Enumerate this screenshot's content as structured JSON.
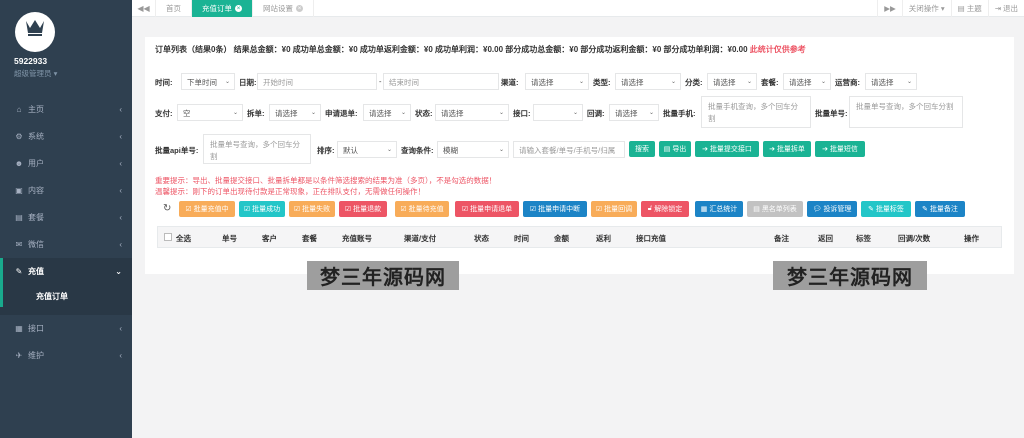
{
  "sidebar": {
    "username": "5922933",
    "role": "超级管理员 ▾",
    "items": [
      {
        "label": "主页",
        "icon": "home-icon",
        "glyph": "⌂"
      },
      {
        "label": "系统",
        "icon": "gears-icon",
        "glyph": "⚙"
      },
      {
        "label": "用户",
        "icon": "users-icon",
        "glyph": "☻"
      },
      {
        "label": "内容",
        "icon": "folder-icon",
        "glyph": "▣"
      },
      {
        "label": "套餐",
        "icon": "file-icon",
        "glyph": "▤"
      },
      {
        "label": "微信",
        "icon": "wechat-icon",
        "glyph": "✉"
      },
      {
        "label": "充值",
        "icon": "edit-icon",
        "glyph": "✎"
      },
      {
        "label": "接口",
        "icon": "doc-icon",
        "glyph": "▦"
      },
      {
        "label": "维护",
        "icon": "wrench-icon",
        "glyph": "✈"
      }
    ],
    "sub_active": "充值订单"
  },
  "topbar": {
    "tabs": [
      {
        "label": "首页"
      },
      {
        "label": "充值订单"
      },
      {
        "label": "网站设置"
      }
    ],
    "close_ops": "关闭操作 ▾",
    "theme": "主题",
    "logout": "退出"
  },
  "summary": {
    "text": "订单列表（结果0条）  结果总金额：¥0  成功单总金额：¥0  成功单返利金额：¥0  成功单利润：¥0.00  部分成功总金额：¥0  部分成功返利金额：¥0  部分成功单利润：¥0.00",
    "note": "此统计仅供参考"
  },
  "filters": {
    "time_label": "时间:",
    "time_select": "下单时间",
    "date_label": "日期:",
    "start_placeholder": "开始时间",
    "dash": "-",
    "end_placeholder": "结束时间",
    "channel_label": "渠道:",
    "channel_select": "请选择",
    "type_label": "类型:",
    "type_select": "请选择",
    "category_label": "分类:",
    "category_select": "请选择",
    "package_label": "套餐:",
    "package_select": "请选择",
    "operator_label": "运营商:",
    "operator_select": "请选择",
    "pay_label": "支付:",
    "pay_select": "空",
    "split_label": "拆单:",
    "split_select": "请选择",
    "refund_label": "申请退单:",
    "refund_select": "请选择",
    "status_label": "状态:",
    "status_select": "请选择",
    "api_label": "接口:",
    "api_select": "",
    "callback_label": "回调:",
    "callback_select": "请选择",
    "phones_label": "批量手机:",
    "phones_placeholder": "批量手机查询，多个回车分割",
    "orders_label": "批量单号:",
    "orders_placeholder": "批量单号查询，多个回车分割",
    "api_orders_label": "批量api单号:",
    "api_orders_placeholder": "批量单号查询，多个回车分割",
    "sort_label": "排序:",
    "sort_select": "默认",
    "query_label": "查询条件:",
    "query_select": "模糊",
    "keyword_placeholder": "请输入套餐/单号/手机号/归属"
  },
  "buttons": {
    "search": "搜索",
    "export": "导出",
    "batch_submit": "批量提交接口",
    "batch_split": "批量拆单",
    "batch_sms": "批量短信"
  },
  "tips": {
    "line1": "重要提示：导出、批量提交接口、批量拆单都是以条件筛选搜索的结果为准（多页），不是勾选的数据！",
    "line2": "温馨提示：刚下的订单出现待付款是正常现象，正在排队支付，无需做任何操作！"
  },
  "actions": [
    {
      "label": "批量充值中",
      "color": "o"
    },
    {
      "label": "批量成功",
      "color": "t"
    },
    {
      "label": "批量失败",
      "color": "o"
    },
    {
      "label": "批量退款",
      "color": "r"
    },
    {
      "label": "批量待充值",
      "color": "o"
    },
    {
      "label": "批量申请退单",
      "color": "r"
    },
    {
      "label": "批量申请中断",
      "color": "b"
    },
    {
      "label": "批量回调",
      "color": "o"
    },
    {
      "label": "解除锁定",
      "color": "r"
    },
    {
      "label": "汇总统计",
      "color": "b"
    },
    {
      "label": "黑名单列表",
      "color": "gy"
    },
    {
      "label": "投诉管理",
      "color": "b"
    },
    {
      "label": "批量标签",
      "color": "t"
    },
    {
      "label": "批量备注",
      "color": "b"
    }
  ],
  "table": {
    "headers": [
      "全选",
      "单号",
      "客户",
      "套餐",
      "充值账号",
      "渠道/支付",
      "状态",
      "时间",
      "金额",
      "返利",
      "接口充值",
      "备注",
      "返回",
      "标签",
      "回调/次数",
      "操作"
    ]
  },
  "watermark": "梦三年源码网"
}
